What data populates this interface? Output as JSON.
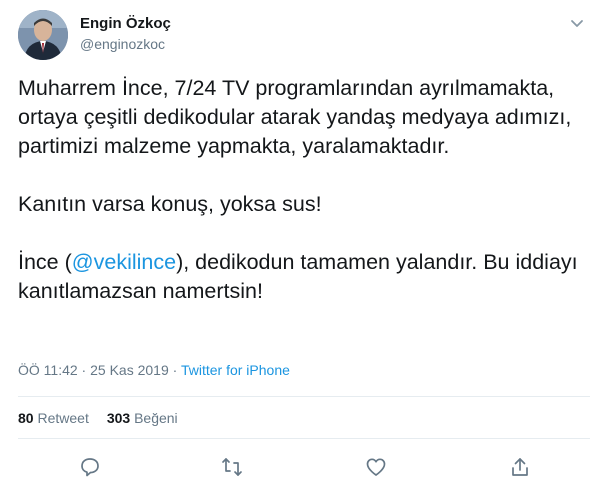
{
  "author": {
    "name": "Engin Özkoç",
    "handle": "@enginozkoc"
  },
  "tweet": {
    "paragraph1": "Muharrem İnce, 7/24 TV programlarından ayrılmamakta, ortaya çeşitli dedikodular atarak yandaş medyaya adımızı, partimizi malzeme yapmakta, yaralamaktadır.",
    "paragraph2": "Kanıtın varsa konuş, yoksa sus!",
    "paragraph3_before": "İnce (",
    "paragraph3_mention": "@vekilince",
    "paragraph3_after": "), dedikodun tamamen yalandır. Bu iddiayı kanıtlamazsan namertsin!"
  },
  "meta": {
    "time": "ÖÖ 11:42",
    "separator": " · ",
    "date": "25 Kas 2019",
    "source": "Twitter for iPhone"
  },
  "stats": {
    "retweet_count": "80",
    "retweet_label": "Retweet",
    "like_count": "303",
    "like_label": "Beğeni"
  },
  "icons": {
    "reply": "reply-icon",
    "retweet": "retweet-icon",
    "like": "heart-icon",
    "share": "share-icon",
    "caret": "chevron-down-icon"
  },
  "colors": {
    "text": "#14171a",
    "secondary": "#657786",
    "link": "#1b95e0",
    "divider": "#e6ecf0"
  }
}
